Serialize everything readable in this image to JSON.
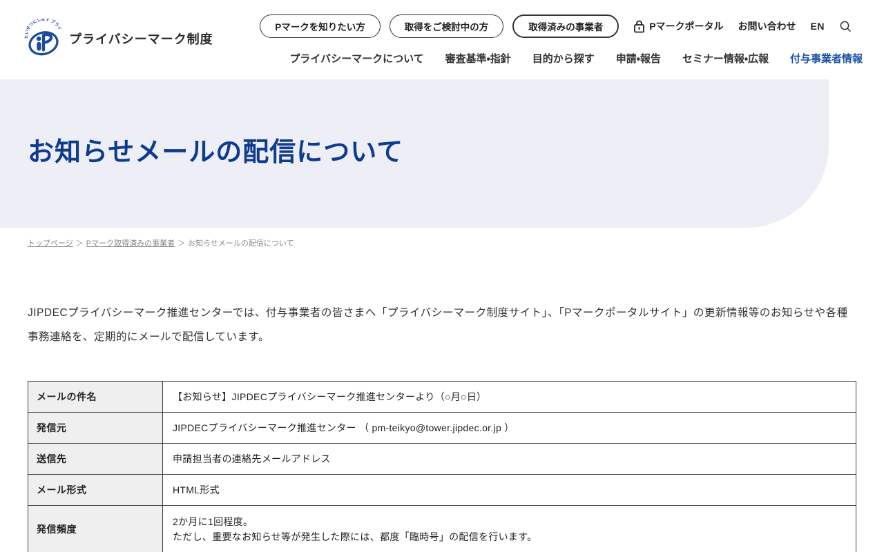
{
  "colors": {
    "brand_blue": "#1c4a9e",
    "heading_blue": "#0d3b8e",
    "nav_active_blue": "#1a50a5",
    "hero_bg": "#edeef6",
    "table_header_bg": "#efefef"
  },
  "header": {
    "logo_text": "プライバシーマーク制度",
    "logo_arc_text": "たいせつにします プライバシー",
    "quick_links": [
      {
        "label": "Pマークを知りたい方"
      },
      {
        "label": "取得をご検討中の方"
      },
      {
        "label": "取得済みの事業者"
      }
    ],
    "portal_label": "Pマークポータル",
    "contact_label": "お問い合わせ",
    "lang_label": "EN",
    "nav": [
      {
        "label": "プライバシーマークについて"
      },
      {
        "label": "審査基準・指針"
      },
      {
        "label": "目的から探す"
      },
      {
        "label": "申請・報告"
      },
      {
        "label": "セミナー情報・広報"
      },
      {
        "label": "付与事業者情報"
      }
    ]
  },
  "hero": {
    "title": "お知らせメールの配信について"
  },
  "breadcrumb": {
    "separator": "＞",
    "items": [
      {
        "label": "トップページ"
      },
      {
        "label": "Pマーク取得済みの事業者"
      },
      {
        "label": "お知らせメールの配信について"
      }
    ]
  },
  "main": {
    "intro": "JIPDECプライバシーマーク推進センターでは、付与事業者の皆さまへ「プライバシーマーク制度サイト」、「Pマークポータルサイト」の更新情報等のお知らせや各種事務連絡を、定期的にメールで配信しています。",
    "table": {
      "rows": [
        {
          "label": "メールの件名",
          "value": "【お知らせ】JIPDECプライバシーマーク推進センターより（○月○日）"
        },
        {
          "label": "発信元",
          "value": "JIPDECプライバシーマーク推進センター （ pm-teikyo@tower.jipdec.or.jp ）"
        },
        {
          "label": "送信先",
          "value": "申請担当者の連絡先メールアドレス"
        },
        {
          "label": "メール形式",
          "value": "HTML形式"
        },
        {
          "label": "発信頻度",
          "value": "2か月に1回程度。",
          "value2": "ただし、重要なお知らせ等が発生した際には、都度「臨時号」の配信を行います。"
        }
      ]
    }
  }
}
